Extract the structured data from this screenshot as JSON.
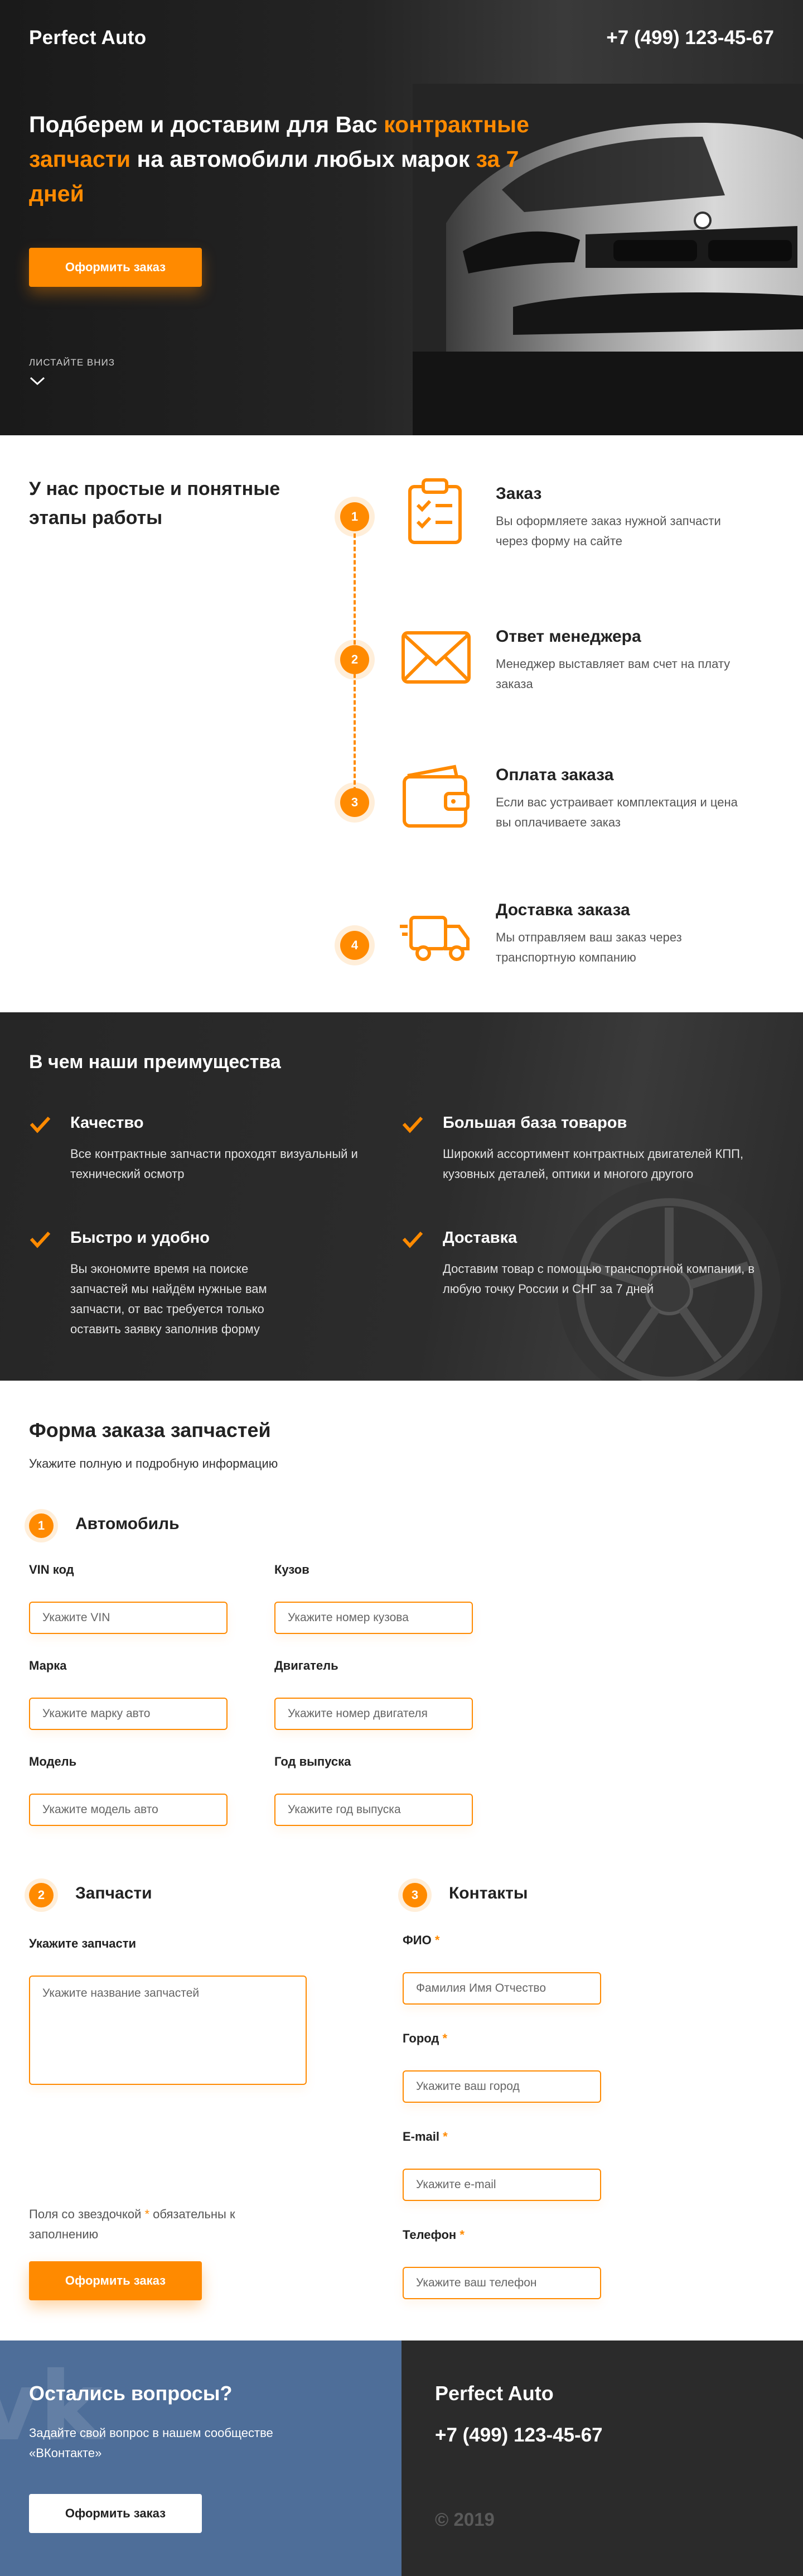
{
  "hero": {
    "logo": "Perfect Auto",
    "phone": "+7 (499) 123-45-67",
    "title_part1": "Подберем и доставим для Вас ",
    "title_highlight1": "контрактные запчасти",
    "title_part2": " на автомобили любых марок ",
    "title_highlight2": "за 7 дней",
    "order_button": "Оформить заказ",
    "scroll_label": "ЛИСТАЙТЕ ВНИЗ"
  },
  "steps": {
    "title": "У нас простые и понятные этапы работы",
    "items": [
      {
        "num": "1",
        "icon": "clipboard-checklist-icon",
        "title": "Заказ",
        "text": "Вы оформляете заказ нужной запчасти через форму на сайте"
      },
      {
        "num": "2",
        "icon": "envelope-icon",
        "title": "Ответ менеджера",
        "text": "Менеджер выставляет вам счет на плату заказа"
      },
      {
        "num": "3",
        "icon": "wallet-icon",
        "title": "Оплата заказа",
        "text": "Если вас устраивает комплектация и цена вы оплачиваете заказ"
      },
      {
        "num": "4",
        "icon": "delivery-truck-icon",
        "title": "Доставка заказа",
        "text": "Мы отправляем ваш заказ через транспортную компанию"
      }
    ]
  },
  "advantages": {
    "title": "В чем наши преимущества",
    "items": [
      {
        "title": "Качество",
        "text": "Все контрактные запчасти проходят визуальный и технический осмотр"
      },
      {
        "title": "Большая база товаров",
        "text": "Широкий ассортимент контрактных двигателей КПП, кузовных деталей, оптики и многого другого"
      },
      {
        "title": "Быстро и удобно",
        "text": "Вы экономите время на поиске запчастей мы найдём нужные вам запчасти, от вас требуется только оставить заявку заполнив форму"
      },
      {
        "title": "Доставка",
        "text": "Доставим товар с помощью транспортной компании, в любую точку России и СНГ за 7 дней"
      }
    ]
  },
  "form": {
    "title": "Форма заказа запчастей",
    "subtitle": "Укажите полную и подробную информацию",
    "car_section": {
      "num": "1",
      "title": "Автомобиль",
      "fields": [
        {
          "label": "VIN код",
          "placeholder": "Укажите VIN"
        },
        {
          "label": "Кузов",
          "placeholder": "Укажите номер кузова"
        },
        {
          "label": "Марка",
          "placeholder": "Укажите марку авто"
        },
        {
          "label": "Двигатель",
          "placeholder": "Укажите номер двигателя"
        },
        {
          "label": "Модель",
          "placeholder": "Укажите модель авто"
        },
        {
          "label": "Год выпуска",
          "placeholder": "Укажите год выпуска"
        }
      ]
    },
    "parts_section": {
      "num": "2",
      "title": "Запчасти",
      "label": "Укажите запчасти",
      "placeholder": "Укажите название запчастей"
    },
    "contacts_section": {
      "num": "3",
      "title": "Контакты",
      "fields": [
        {
          "label": "ФИО",
          "placeholder": "Фамилия Имя Отчество"
        },
        {
          "label": "Город",
          "placeholder": "Укажите ваш город"
        },
        {
          "label": "E-mail",
          "placeholder": "Укажите e-mail"
        },
        {
          "label": "Телефон",
          "placeholder": "Укажите ваш телефон"
        }
      ]
    },
    "required_star": "*",
    "note_part1": "Поля со звездочкой ",
    "note_part2": " обязательны к заполнению",
    "submit_button": "Оформить заказ"
  },
  "footer": {
    "vk_logo_text": "vk",
    "question_title": "Остались вопросы?",
    "question_text": "Задайте свой вопрос в нашем сообществе «ВКонтакте»",
    "button": "Оформить заказ",
    "logo": "Perfect Auto",
    "phone": "+7 (499) 123-45-67",
    "copyright": "© 2019"
  },
  "colors": {
    "accent": "#ff8a00",
    "dark": "#262626",
    "footer_blue": "#4e6e99"
  }
}
